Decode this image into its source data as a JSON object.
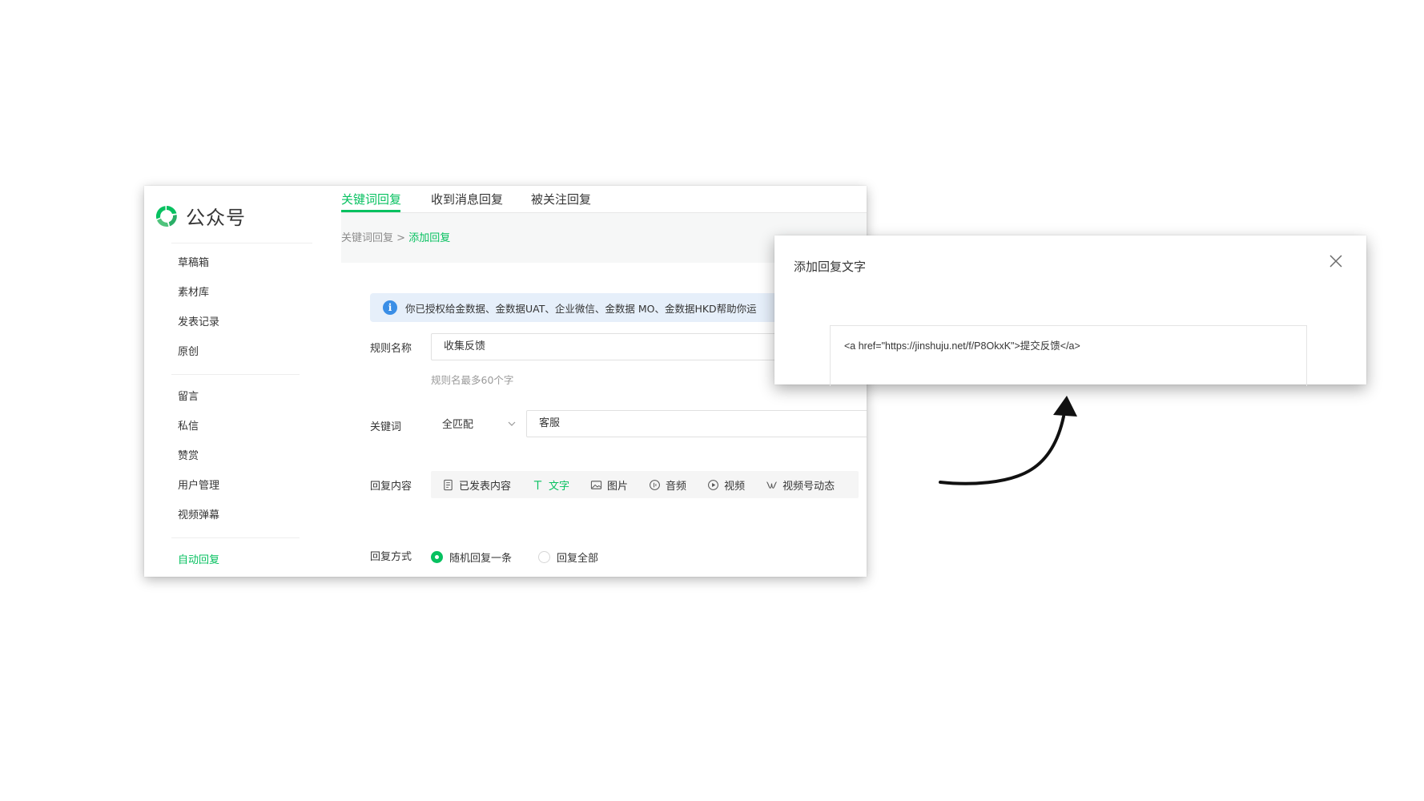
{
  "app": {
    "name": "公众号"
  },
  "sidebar": {
    "items": [
      {
        "label": "草稿箱"
      },
      {
        "label": "素材库"
      },
      {
        "label": "发表记录"
      },
      {
        "label": "原创"
      },
      {
        "label": "留言"
      },
      {
        "label": "私信"
      },
      {
        "label": "赞赏"
      },
      {
        "label": "用户管理"
      },
      {
        "label": "视频弹幕"
      },
      {
        "label": "自动回复",
        "active": true
      }
    ]
  },
  "tabs": [
    {
      "label": "关键词回复",
      "active": true
    },
    {
      "label": "收到消息回复"
    },
    {
      "label": "被关注回复"
    }
  ],
  "breadcrumb": {
    "parent": "关键词回复",
    "separator": ">",
    "current": "添加回复"
  },
  "form": {
    "notice": "你已授权给金数据、金数据UAT、企业微信、金数据 MO、金数据HKD帮助你运",
    "rule_name_label": "规则名称",
    "rule_name_value": "收集反馈",
    "rule_name_hint": "规则名最多60个字",
    "keyword_label": "关键词",
    "match_mode": "全匹配",
    "keyword_value": "客服",
    "reply_content_label": "回复内容",
    "reply_types": [
      {
        "label": "已发表内容",
        "icon": "document-icon"
      },
      {
        "label": "文字",
        "icon": "text-icon",
        "active": true
      },
      {
        "label": "图片",
        "icon": "image-icon"
      },
      {
        "label": "音频",
        "icon": "audio-icon"
      },
      {
        "label": "视频",
        "icon": "video-icon"
      },
      {
        "label": "视频号动态",
        "icon": "channels-icon"
      }
    ],
    "reply_mode_label": "回复方式",
    "reply_modes": [
      {
        "label": "随机回复一条",
        "checked": true
      },
      {
        "label": "回复全部",
        "checked": false
      }
    ]
  },
  "dialog": {
    "title": "添加回复文字",
    "content": "<a href=\"https://jinshuju.net/f/P8OkxK\">提交反馈</a>"
  },
  "colors": {
    "accent": "#07c160",
    "notice_bg": "#e6effa",
    "info": "#3a8ee6"
  }
}
